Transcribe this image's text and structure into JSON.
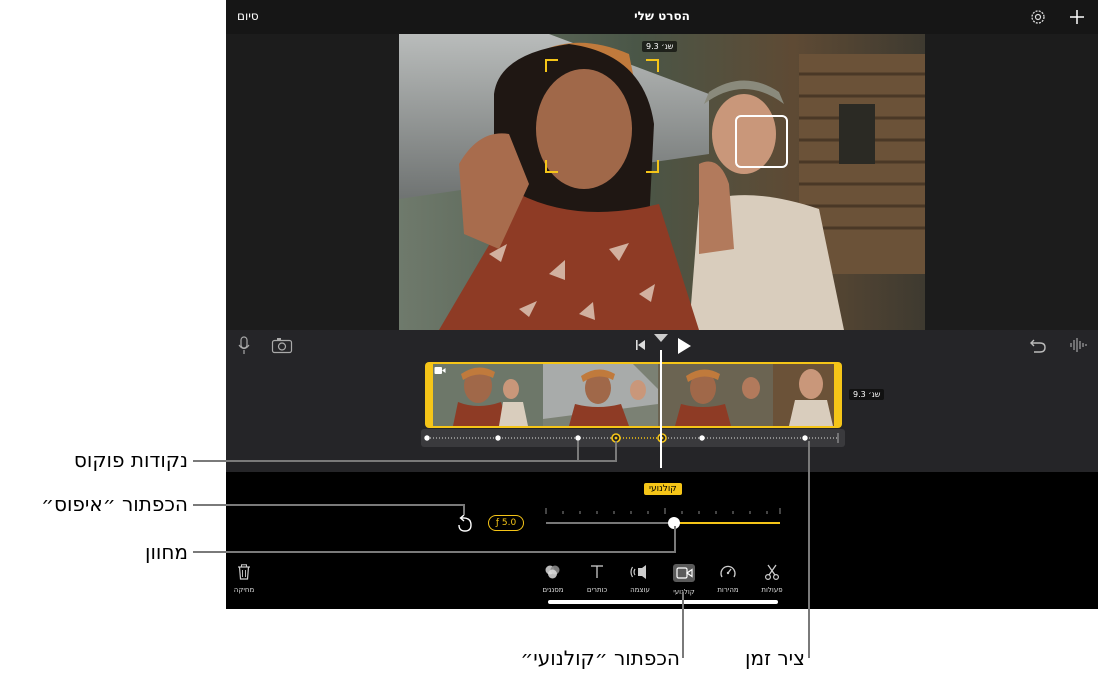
{
  "header": {
    "done_label": "סיום",
    "title": "הסרט שלי"
  },
  "preview": {
    "duration": "9.3 שנ׳"
  },
  "timeline": {
    "clip_duration": "9.3 שנ׳"
  },
  "cinematic": {
    "badge": "קולנועי",
    "aperture": "ƒ 5.0"
  },
  "toolbar": {
    "delete_label": "מחיקה",
    "items": [
      {
        "label": "מסננים",
        "icon": "filters-icon"
      },
      {
        "label": "כותרים",
        "icon": "titles-icon"
      },
      {
        "label": "עוצמה",
        "icon": "volume-icon"
      },
      {
        "label": "קולנועי",
        "icon": "cinematic-icon"
      },
      {
        "label": "מהירות",
        "icon": "speed-icon"
      },
      {
        "label": "פעולות",
        "icon": "actions-icon"
      }
    ]
  },
  "callouts": {
    "focus_points": "נקודות פוקוס",
    "reset_button": "הכפתור ״איפוס״",
    "slider": "מחוון",
    "cinematic_button": "הכפתור ״קולנועי״",
    "timeline": "ציר זמן"
  },
  "colors": {
    "accent": "#f5c518",
    "background": "#000000",
    "panel": "#252528"
  }
}
